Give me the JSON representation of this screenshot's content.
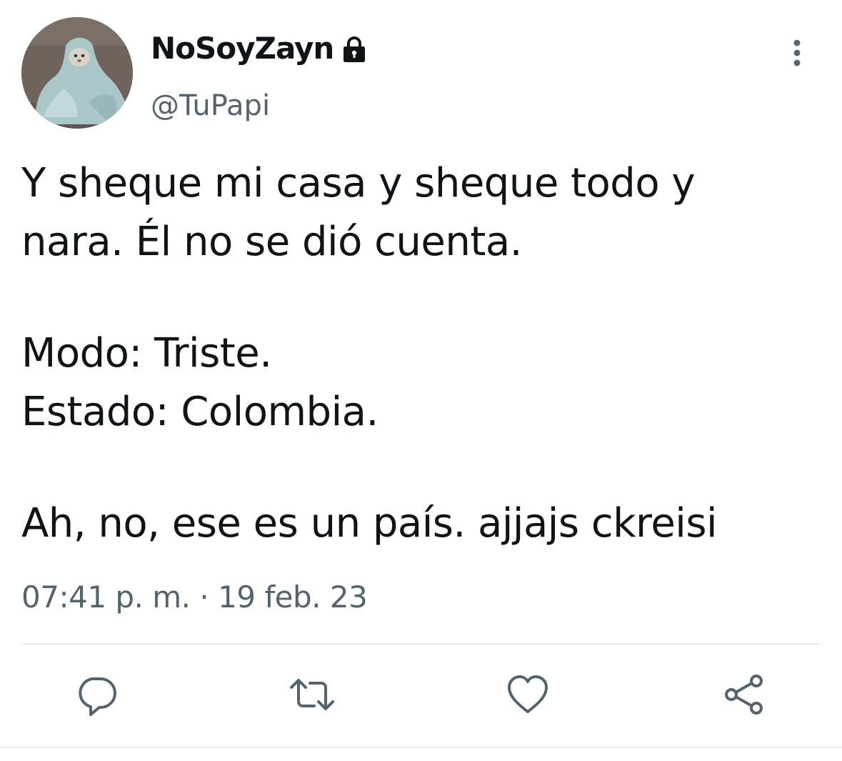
{
  "user": {
    "display_name": "NoSoyZayn",
    "handle": "@TuPapi",
    "protected_icon": "lock-icon",
    "avatar": "avatar"
  },
  "tweet": {
    "lines_paragraph_1": [
      "Y sheque mi casa y sheque todo y",
      "nara. Él no se dió cuenta."
    ],
    "lines_paragraph_2": [
      "Modo: Triste.",
      "Estado: Colombia."
    ],
    "lines_paragraph_3": [
      "Ah, no, ese es un país. ajjajs ckreisi"
    ],
    "timestamp": "07:41 p. m. · 19 feb. 23"
  },
  "actions": [
    {
      "name": "reply",
      "icon": "reply-icon"
    },
    {
      "name": "retweet",
      "icon": "retweet-icon"
    },
    {
      "name": "like",
      "icon": "heart-icon"
    },
    {
      "name": "share",
      "icon": "share-icon"
    }
  ],
  "menu": {
    "icon": "more-vertical-icon"
  },
  "colors": {
    "text": "#0f1419",
    "secondary": "#536471",
    "divider": "#e7ebee"
  }
}
